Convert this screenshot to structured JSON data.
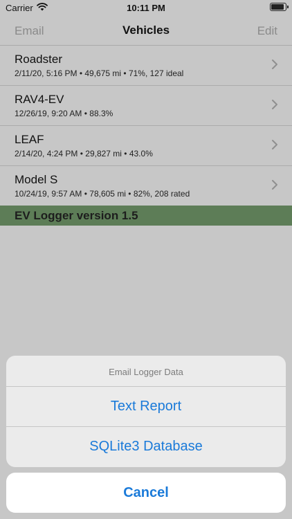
{
  "status_bar": {
    "carrier": "Carrier",
    "time": "10:11 PM",
    "wifi_icon": "wifi-icon",
    "battery_icon": "battery-icon"
  },
  "nav": {
    "left_button": "Email",
    "title": "Vehicles",
    "right_button": "Edit"
  },
  "vehicles": [
    {
      "name": "Roadster",
      "detail": "2/11/20, 5:16 PM • 49,675 mi • 71%, 127 ideal"
    },
    {
      "name": "RAV4-EV",
      "detail": "12/26/19, 9:20 AM • 88.3%"
    },
    {
      "name": "LEAF",
      "detail": "2/14/20, 4:24 PM • 29,827 mi • 43.0%"
    },
    {
      "name": "Model S",
      "detail": "10/24/19, 9:57 AM • 78,605 mi • 82%, 208 rated"
    }
  ],
  "footer_banner": "EV Logger version 1.5",
  "action_sheet": {
    "title": "Email Logger Data",
    "options": [
      "Text Report",
      "SQLite3 Database"
    ],
    "cancel": "Cancel"
  },
  "colors": {
    "accent": "#1a7ad9",
    "banner": "#5d7d57",
    "dimmed_background": "#c7c7c7"
  }
}
